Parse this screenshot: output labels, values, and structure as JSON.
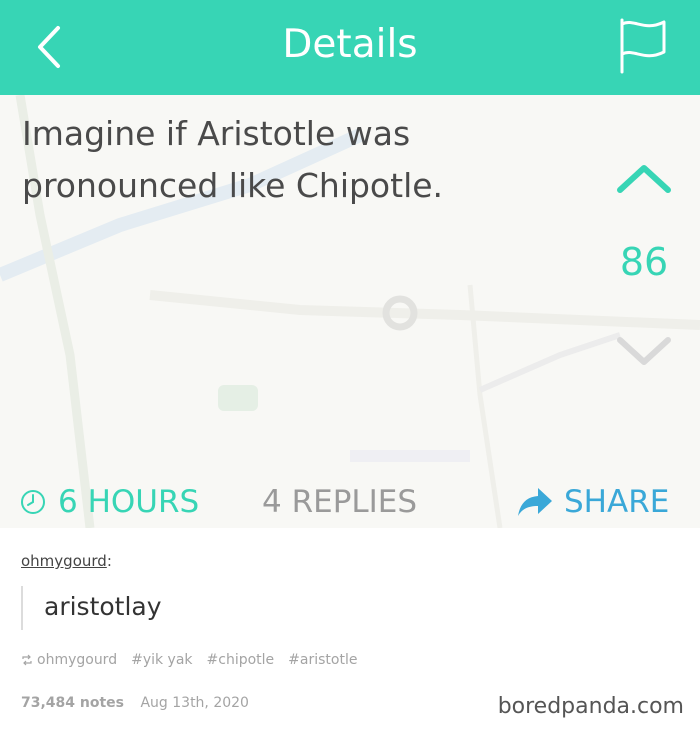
{
  "header": {
    "title": "Details",
    "accent_color": "#37d5b5",
    "back_icon": "chevron-left-icon",
    "flag_icon": "flag-icon"
  },
  "yak": {
    "text_line1": "Imagine if Aristotle was",
    "text_line2": "pronounced like Chipotle.",
    "vote_count": "86",
    "time": "6 HOURS",
    "replies": "4 REPLIES",
    "share": "SHARE"
  },
  "post": {
    "username": "ohmygourd",
    "username_suffix": ":",
    "reply_text": "aristotlay",
    "reblog_user": "ohmygourd",
    "tags": [
      "#yik yak",
      "#chipotle",
      "#aristotle"
    ],
    "notes": "73,484 notes",
    "date": "Aug 13th, 2020",
    "watermark": "boredpanda.com"
  }
}
